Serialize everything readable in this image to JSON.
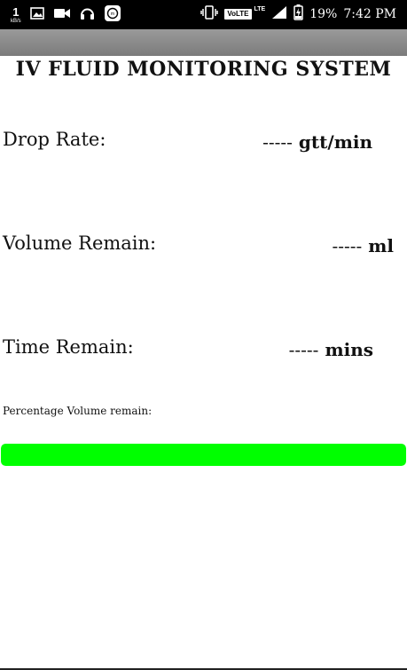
{
  "status_bar": {
    "network_speed": "1",
    "network_speed_unit": "kB/s",
    "left_icons": [
      "gallery-icon",
      "video-camera-icon",
      "headphones-icon",
      "app-notification-icon"
    ],
    "right_icons": [
      "vibrate-icon",
      "volte-icon",
      "signal-icon",
      "battery-charging-icon"
    ],
    "volte_label": "VoLTE",
    "lte_label": "LTE",
    "battery_percent": "19%",
    "time": "7:42 PM"
  },
  "app": {
    "title": "IV FLUID MONITORING SYSTEM"
  },
  "readings": {
    "drop_rate": {
      "label": "Drop Rate:",
      "value": "-----",
      "unit": "gtt/min"
    },
    "volume_remain": {
      "label": "Volume Remain:",
      "value": "-----",
      "unit": "ml"
    },
    "time_remain": {
      "label": "Time Remain:",
      "value": "-----",
      "unit": "mins"
    }
  },
  "progress": {
    "label": "Percentage Volume remain:",
    "fraction": 1.0,
    "color": "#00ff00"
  }
}
